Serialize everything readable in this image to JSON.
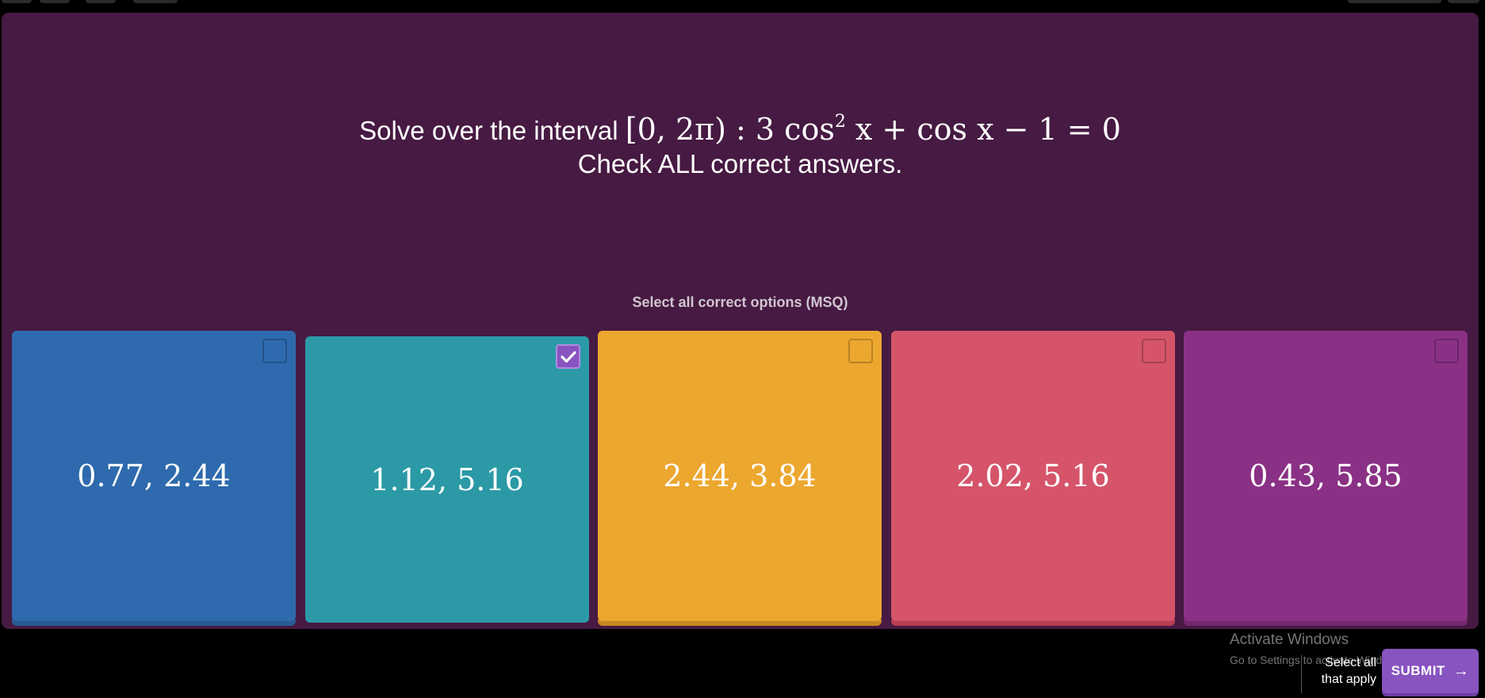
{
  "question": {
    "prefix": "Solve over the interval",
    "interval": "[0, 2π) :",
    "equation_part1": "3 cos",
    "exponent": "2",
    "equation_part2": " x + cos x − 1 = 0",
    "line2": "Check ALL correct answers."
  },
  "instruction": "Select all correct options (MSQ)",
  "options": [
    {
      "text": "0.77, 2.44",
      "color": "#2e6aad",
      "shadow": "#275b93",
      "selected": false
    },
    {
      "text": "1.12, 5.16",
      "color": "#2b9aa6",
      "shadow": "#23828d",
      "selected": true
    },
    {
      "text": "2.44, 3.84",
      "color": "#eca72f",
      "shadow": "#c88a1f",
      "selected": false
    },
    {
      "text": "2.02, 5.16",
      "color": "#d5546a",
      "shadow": "#b83d52",
      "selected": false
    },
    {
      "text": "0.43, 5.85",
      "color": "#8a3185",
      "shadow": "#72276e",
      "selected": false
    }
  ],
  "watermark": {
    "title": "Activate Windows",
    "subtitle": "Go to Settings to activate Windows."
  },
  "footer": {
    "hint": "Select all that apply",
    "submit_label": "SUBMIT"
  }
}
